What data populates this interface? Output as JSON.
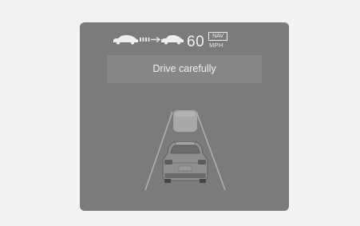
{
  "display": {
    "speed_value": "60",
    "speed_unit": "MPH",
    "nav_label": "NAV",
    "message": "Drive carefully"
  },
  "icons": {
    "lead_car": "car-side-icon",
    "following_distance": "distance-bars-icon",
    "own_car": "car-side-icon",
    "vehicle_ahead": "vehicle-ahead-icon",
    "own_vehicle": "own-vehicle-rear-icon"
  },
  "colors": {
    "panel_bg": "#7b7b7b",
    "message_bg": "#878787",
    "text": "#f0f0f0",
    "page_bg": "#f3f3f3"
  }
}
